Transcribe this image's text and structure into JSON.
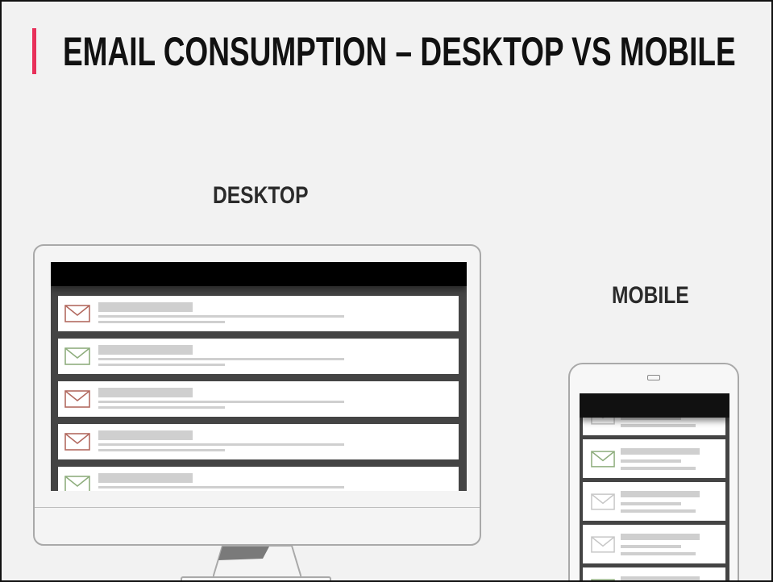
{
  "title": "EMAIL CONSUMPTION – DESKTOP VS MOBILE",
  "labels": {
    "desktop": "DESKTOP",
    "mobile": "MOBILE"
  },
  "colors": {
    "accent": "#e8305a",
    "envelope_red": "#b36a60",
    "envelope_green": "#8fae7e",
    "envelope_light": "#c8c8c8"
  },
  "desktop_inbox": {
    "icons": [
      "envelope-icon",
      "envelope-icon",
      "envelope-icon",
      "envelope-icon",
      "envelope-icon"
    ],
    "envelope_colors": [
      "red",
      "green",
      "red",
      "red",
      "green"
    ]
  },
  "mobile_inbox": {
    "icons": [
      "envelope-icon",
      "envelope-icon",
      "envelope-icon",
      "envelope-icon",
      "envelope-icon"
    ],
    "envelope_colors": [
      "light",
      "green",
      "light",
      "light",
      "green"
    ]
  }
}
